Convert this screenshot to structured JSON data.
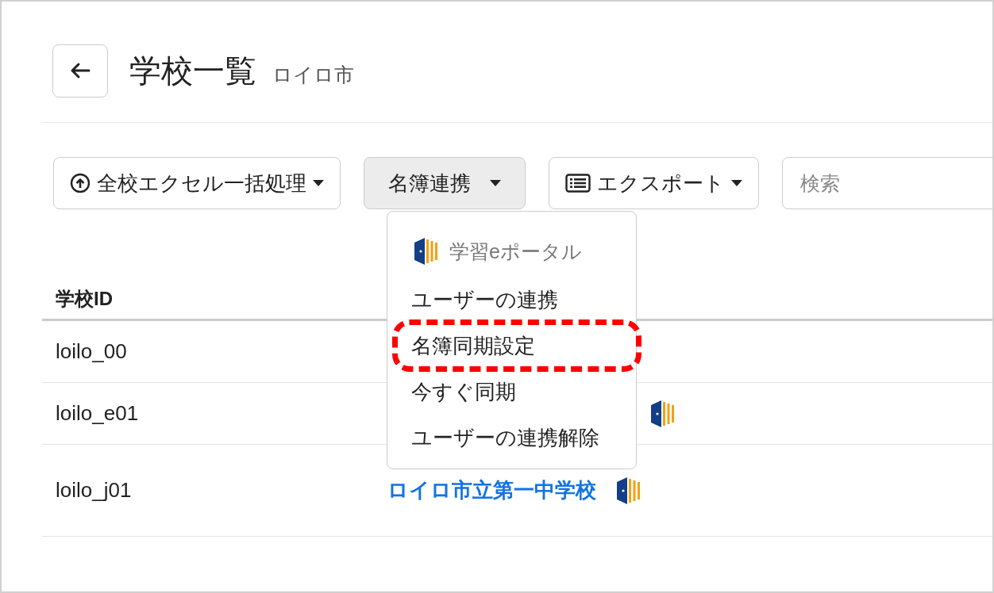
{
  "header": {
    "title": "学校一覧",
    "subtitle": "ロイロ市"
  },
  "toolbar": {
    "buttons": [
      {
        "label": "全校エクセル一括処理",
        "kind": "upload",
        "active": false
      },
      {
        "label": "名簿連携",
        "kind": "plain",
        "active": true
      },
      {
        "label": "エクスポート",
        "kind": "list",
        "active": false
      }
    ],
    "search": {
      "placeholder": "検索"
    }
  },
  "dropdown": {
    "header": "学習eポータル",
    "items": [
      {
        "label": "ユーザーの連携",
        "highlighted": false
      },
      {
        "label": "名簿同期設定",
        "highlighted": true
      },
      {
        "label": "今すぐ同期",
        "highlighted": false
      },
      {
        "label": "ユーザーの連携解除",
        "highlighted": false
      }
    ]
  },
  "table": {
    "columns": [
      {
        "label": "学校ID"
      }
    ],
    "rows": [
      {
        "id": "loilo_00",
        "linked": false
      },
      {
        "id": "loilo_e01",
        "linked": true
      },
      {
        "id": "loilo_j01",
        "name": "ロイロ市立第一中学校",
        "linked": true
      }
    ]
  }
}
